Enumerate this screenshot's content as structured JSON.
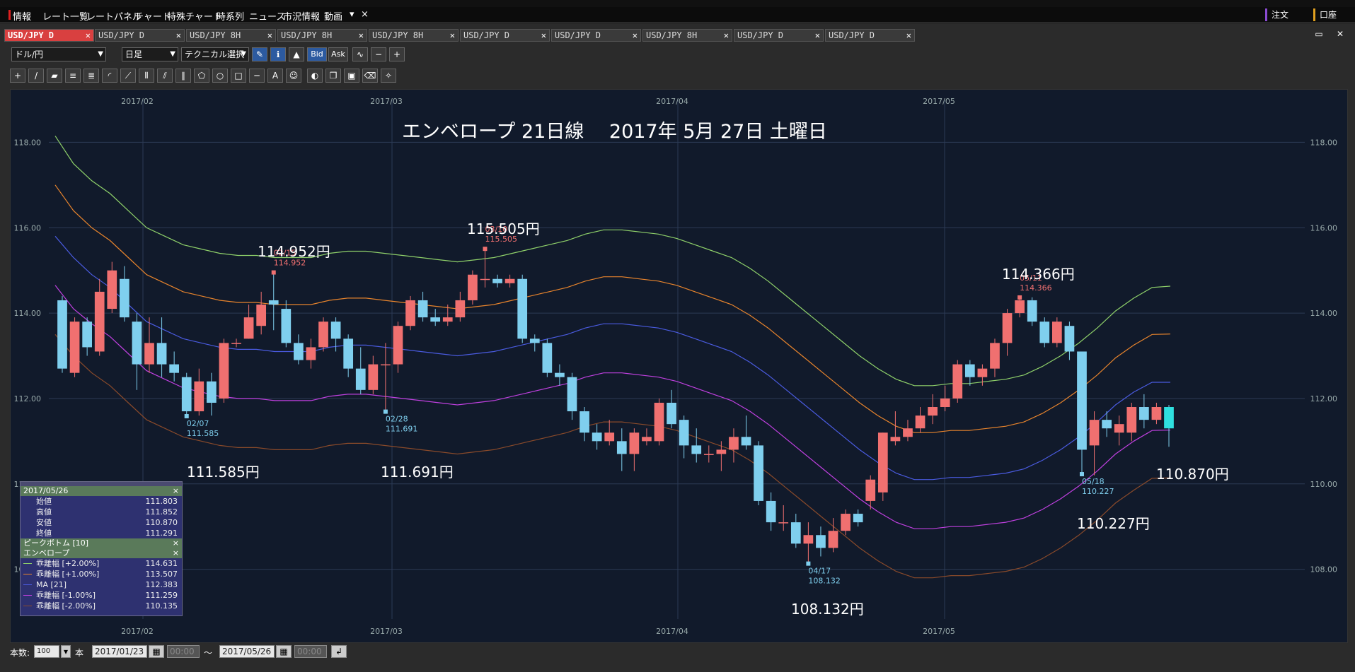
{
  "menubar": {
    "items": [
      "情報",
      "レート一覧",
      "レートパネル",
      "チャート",
      "特殊チャート",
      "時系列",
      "ニュース",
      "市況情報",
      "動画"
    ],
    "close": "×",
    "more": "▾",
    "right_buttons": [
      "注文",
      "口座"
    ]
  },
  "tabs": [
    {
      "label": "USD/JPY D",
      "active": true
    },
    {
      "label": "USD/JPY D",
      "active": false
    },
    {
      "label": "USD/JPY 8H",
      "active": false
    },
    {
      "label": "USD/JPY 8H",
      "active": false
    },
    {
      "label": "USD/JPY 8H",
      "active": false
    },
    {
      "label": "USD/JPY D",
      "active": false
    },
    {
      "label": "USD/JPY D",
      "active": false
    },
    {
      "label": "USD/JPY 8H",
      "active": false
    },
    {
      "label": "USD/JPY D",
      "active": false
    },
    {
      "label": "USD/JPY D",
      "active": false
    }
  ],
  "toolbar": {
    "pair": "ドル/円",
    "timeframe": "日足",
    "technical": "テクニカル選択",
    "bid": "Bid",
    "ask": "Ask"
  },
  "chart_title": "エンベロープ 21日線　 2017年 5月 27日 土曜日",
  "annotations": [
    {
      "id": "a1",
      "text": "114.952円"
    },
    {
      "id": "a2",
      "text": "115.505円"
    },
    {
      "id": "a3",
      "text": "114.366円"
    },
    {
      "id": "a4",
      "text": "111.585円"
    },
    {
      "id": "a5",
      "text": "111.691円"
    },
    {
      "id": "a6",
      "text": "108.132円"
    },
    {
      "id": "a7",
      "text": "110.870円"
    },
    {
      "id": "a8",
      "text": "110.227円"
    }
  ],
  "infopanel": {
    "date": "2017/05/26",
    "ohlc": [
      {
        "k": "始値",
        "v": "111.803"
      },
      {
        "k": "高値",
        "v": "111.852"
      },
      {
        "k": "安値",
        "v": "110.870"
      },
      {
        "k": "終値",
        "v": "111.291"
      }
    ],
    "peak_section": "ピークボトム [10]",
    "env_section": "エンベロープ",
    "env_rows": [
      {
        "k": "乖離幅 [+2.00%]",
        "v": "114.631",
        "color": "#8fd16a"
      },
      {
        "k": "乖離幅 [+1.00%]",
        "v": "113.507",
        "color": "#e8842c"
      },
      {
        "k": "MA [21]",
        "v": "112.383",
        "color": "#4a5be0"
      },
      {
        "k": "乖離幅 [-1.00%]",
        "v": "111.259",
        "color": "#c040e0"
      },
      {
        "k": "乖離幅 [-2.00%]",
        "v": "110.135",
        "color": "#8a4a2a"
      }
    ],
    "close": "×"
  },
  "bottombar": {
    "count_label": "本数:",
    "count_value": "100",
    "unit": "本",
    "from_date": "2017/01/23",
    "from_time": "00:00",
    "tilde": "～",
    "to_date": "2017/05/26",
    "to_time": "00:00"
  },
  "chart_data": {
    "type": "candlestick",
    "title": "エンベロープ 21日線　 2017年 5月 27日 土曜日",
    "x_axis_labels": [
      "2017/02",
      "2017/03",
      "2017/04",
      "2017/05"
    ],
    "y_ticks": [
      "108.00",
      "110.00",
      "112.00",
      "114.00",
      "116.00",
      "118.00"
    ],
    "ylim": [
      107.0,
      119.0
    ],
    "grid": true,
    "marker_labels": [
      {
        "date": "02/15",
        "value": "114.952",
        "kind": "peak"
      },
      {
        "date": "03/10",
        "value": "115.505",
        "kind": "peak"
      },
      {
        "date": "05/11",
        "value": "114.366",
        "kind": "peak"
      },
      {
        "date": "02/07",
        "value": "111.585",
        "kind": "bottom"
      },
      {
        "date": "02/28",
        "value": "111.691",
        "kind": "bottom"
      },
      {
        "date": "04/17",
        "value": "108.132",
        "kind": "bottom"
      },
      {
        "date": "05/18",
        "value": "110.227",
        "kind": "bottom"
      }
    ],
    "candles": [
      [
        114.3,
        112.7,
        114.4,
        112.6
      ],
      [
        112.6,
        113.8,
        113.9,
        112.5
      ],
      [
        113.8,
        113.2,
        113.9,
        113.0
      ],
      [
        113.1,
        114.5,
        114.8,
        113.0
      ],
      [
        114.1,
        115.0,
        115.2,
        114.0
      ],
      [
        114.8,
        113.9,
        115.1,
        113.8
      ],
      [
        113.8,
        112.8,
        114.0,
        112.2
      ],
      [
        112.8,
        113.3,
        113.9,
        112.6
      ],
      [
        113.3,
        112.8,
        113.9,
        112.5
      ],
      [
        112.8,
        112.6,
        113.1,
        112.4
      ],
      [
        112.5,
        111.7,
        112.6,
        111.6
      ],
      [
        111.7,
        112.4,
        112.7,
        111.6
      ],
      [
        112.4,
        111.9,
        112.6,
        111.6
      ],
      [
        112.0,
        113.3,
        113.4,
        111.9
      ],
      [
        113.3,
        113.3,
        113.4,
        113.2
      ],
      [
        113.4,
        113.9,
        114.2,
        113.4
      ],
      [
        113.7,
        114.2,
        114.5,
        113.5
      ],
      [
        114.3,
        114.2,
        114.95,
        113.6
      ],
      [
        114.1,
        113.3,
        114.3,
        113.2
      ],
      [
        113.3,
        112.9,
        113.5,
        112.8
      ],
      [
        112.9,
        113.2,
        113.4,
        112.7
      ],
      [
        113.2,
        113.8,
        113.9,
        113.1
      ],
      [
        113.8,
        113.4,
        113.9,
        113.1
      ],
      [
        113.4,
        112.7,
        113.5,
        112.5
      ],
      [
        112.7,
        112.2,
        113.2,
        112.1
      ],
      [
        112.2,
        112.8,
        113.0,
        112.1
      ],
      [
        112.8,
        112.8,
        113.3,
        111.7
      ],
      [
        112.8,
        113.7,
        113.8,
        112.6
      ],
      [
        113.7,
        114.3,
        114.4,
        113.6
      ],
      [
        114.3,
        113.9,
        114.5,
        113.8
      ],
      [
        113.9,
        113.8,
        114.1,
        113.7
      ],
      [
        113.8,
        113.9,
        114.2,
        113.7
      ],
      [
        113.9,
        114.3,
        114.5,
        113.8
      ],
      [
        114.3,
        114.9,
        115.0,
        114.2
      ],
      [
        114.8,
        114.8,
        115.5,
        114.6
      ],
      [
        114.8,
        114.7,
        114.9,
        114.6
      ],
      [
        114.7,
        114.8,
        114.9,
        114.6
      ],
      [
        114.8,
        113.4,
        114.9,
        113.3
      ],
      [
        113.4,
        113.3,
        113.5,
        113.1
      ],
      [
        113.3,
        112.6,
        113.4,
        112.5
      ],
      [
        112.6,
        112.5,
        112.8,
        112.3
      ],
      [
        112.5,
        111.7,
        112.6,
        111.5
      ],
      [
        111.7,
        111.2,
        111.8,
        111.0
      ],
      [
        111.2,
        111.0,
        111.4,
        110.8
      ],
      [
        111.0,
        111.2,
        111.5,
        110.9
      ],
      [
        111.0,
        110.7,
        111.3,
        110.3
      ],
      [
        110.7,
        111.2,
        111.3,
        110.3
      ],
      [
        111.0,
        111.1,
        111.3,
        110.9
      ],
      [
        111.0,
        111.9,
        112.0,
        110.9
      ],
      [
        111.9,
        111.4,
        112.2,
        111.3
      ],
      [
        111.5,
        110.9,
        111.6,
        110.6
      ],
      [
        110.9,
        110.7,
        111.3,
        110.5
      ],
      [
        110.7,
        110.7,
        110.9,
        110.5
      ],
      [
        110.7,
        110.8,
        111.0,
        110.3
      ],
      [
        110.8,
        111.1,
        111.3,
        110.5
      ],
      [
        111.1,
        110.9,
        111.6,
        110.8
      ],
      [
        110.9,
        109.6,
        111.0,
        109.5
      ],
      [
        109.6,
        109.1,
        109.8,
        108.9
      ],
      [
        109.1,
        109.1,
        109.5,
        108.9
      ],
      [
        109.1,
        108.6,
        109.3,
        108.5
      ],
      [
        108.6,
        108.8,
        109.1,
        108.1
      ],
      [
        108.8,
        108.5,
        109.0,
        108.3
      ],
      [
        108.5,
        108.9,
        109.2,
        108.4
      ],
      [
        108.9,
        109.3,
        109.4,
        108.8
      ],
      [
        109.3,
        109.1,
        109.4,
        109.0
      ],
      [
        109.6,
        110.1,
        110.2,
        109.4
      ],
      [
        109.8,
        111.2,
        111.2,
        109.6
      ],
      [
        111.0,
        111.1,
        111.7,
        110.9
      ],
      [
        111.1,
        111.3,
        111.5,
        111.0
      ],
      [
        111.3,
        111.6,
        111.8,
        111.2
      ],
      [
        111.6,
        111.8,
        112.1,
        111.4
      ],
      [
        111.8,
        112.0,
        112.3,
        111.7
      ],
      [
        112.0,
        112.8,
        112.9,
        111.9
      ],
      [
        112.8,
        112.5,
        112.9,
        112.3
      ],
      [
        112.5,
        112.7,
        112.8,
        112.3
      ],
      [
        112.7,
        113.3,
        113.4,
        112.5
      ],
      [
        113.3,
        114.0,
        114.1,
        113.0
      ],
      [
        114.0,
        114.3,
        114.4,
        113.9
      ],
      [
        114.3,
        113.8,
        114.37,
        113.7
      ],
      [
        113.8,
        113.3,
        113.9,
        113.2
      ],
      [
        113.3,
        113.8,
        113.9,
        113.2
      ],
      [
        113.7,
        113.1,
        113.8,
        112.9
      ],
      [
        113.1,
        110.8,
        113.1,
        110.2
      ],
      [
        110.9,
        111.5,
        111.7,
        110.2
      ],
      [
        111.5,
        111.3,
        111.7,
        111.1
      ],
      [
        111.2,
        111.4,
        111.6,
        110.9
      ],
      [
        111.2,
        111.8,
        111.9,
        111.0
      ],
      [
        111.8,
        111.5,
        112.1,
        111.3
      ],
      [
        111.5,
        111.8,
        111.9,
        111.4
      ],
      [
        111.8,
        111.3,
        111.85,
        110.87
      ]
    ],
    "series": [
      {
        "name": "乖離幅 [+2.00%]",
        "color": "#8fd16a",
        "values": [
          118.15,
          117.5,
          117.1,
          116.8,
          116.4,
          116.0,
          115.8,
          115.6,
          115.5,
          115.4,
          115.35,
          115.35,
          115.3,
          115.3,
          115.3,
          115.4,
          115.45,
          115.45,
          115.4,
          115.35,
          115.3,
          115.25,
          115.2,
          115.25,
          115.3,
          115.4,
          115.5,
          115.6,
          115.7,
          115.85,
          115.95,
          115.95,
          115.9,
          115.85,
          115.75,
          115.6,
          115.45,
          115.3,
          115.05,
          114.75,
          114.4,
          114.05,
          113.7,
          113.35,
          113.0,
          112.7,
          112.45,
          112.3,
          112.3,
          112.35,
          112.35,
          112.4,
          112.45,
          112.55,
          112.75,
          113.0,
          113.3,
          113.65,
          114.05,
          114.35,
          114.6,
          114.63
        ]
      },
      {
        "name": "乖離幅 [+1.00%]",
        "color": "#e8842c",
        "values": [
          117.0,
          116.4,
          116.0,
          115.7,
          115.3,
          114.9,
          114.7,
          114.5,
          114.4,
          114.3,
          114.25,
          114.25,
          114.2,
          114.2,
          114.2,
          114.3,
          114.35,
          114.35,
          114.3,
          114.25,
          114.2,
          114.15,
          114.1,
          114.15,
          114.2,
          114.3,
          114.4,
          114.5,
          114.6,
          114.75,
          114.85,
          114.85,
          114.8,
          114.75,
          114.65,
          114.5,
          114.35,
          114.2,
          113.95,
          113.65,
          113.3,
          112.95,
          112.6,
          112.25,
          111.9,
          111.6,
          111.35,
          111.2,
          111.2,
          111.25,
          111.25,
          111.3,
          111.35,
          111.45,
          111.65,
          111.9,
          112.2,
          112.55,
          112.95,
          113.25,
          113.5,
          113.51
        ]
      },
      {
        "name": "MA [21]",
        "color": "#4a5be0",
        "values": [
          115.8,
          115.3,
          114.9,
          114.6,
          114.2,
          113.8,
          113.6,
          113.4,
          113.3,
          113.2,
          113.15,
          113.15,
          113.1,
          113.1,
          113.1,
          113.2,
          113.25,
          113.25,
          113.2,
          113.15,
          113.1,
          113.05,
          113.0,
          113.05,
          113.1,
          113.2,
          113.3,
          113.4,
          113.5,
          113.65,
          113.75,
          113.75,
          113.7,
          113.65,
          113.55,
          113.4,
          113.25,
          113.1,
          112.85,
          112.55,
          112.2,
          111.85,
          111.5,
          111.15,
          110.8,
          110.5,
          110.25,
          110.1,
          110.1,
          110.15,
          110.15,
          110.2,
          110.25,
          110.35,
          110.55,
          110.8,
          111.1,
          111.45,
          111.85,
          112.15,
          112.38,
          112.38
        ]
      },
      {
        "name": "乖離幅 [-1.00%]",
        "color": "#c040e0",
        "values": [
          114.65,
          114.1,
          113.75,
          113.45,
          113.05,
          112.65,
          112.45,
          112.25,
          112.15,
          112.05,
          112.0,
          112.0,
          111.95,
          111.95,
          111.95,
          112.05,
          112.1,
          112.1,
          112.05,
          112.0,
          111.95,
          111.9,
          111.85,
          111.9,
          111.95,
          112.05,
          112.15,
          112.25,
          112.35,
          112.5,
          112.6,
          112.6,
          112.55,
          112.5,
          112.4,
          112.25,
          112.1,
          111.95,
          111.7,
          111.4,
          111.05,
          110.7,
          110.35,
          110.0,
          109.65,
          109.35,
          109.1,
          108.95,
          108.95,
          109.0,
          109.0,
          109.05,
          109.1,
          109.2,
          109.4,
          109.65,
          109.95,
          110.3,
          110.7,
          111.0,
          111.25,
          111.26
        ]
      },
      {
        "name": "乖離幅 [-2.00%]",
        "color": "#8a4a2a",
        "values": [
          113.5,
          113.0,
          112.6,
          112.3,
          111.9,
          111.5,
          111.3,
          111.1,
          111.0,
          110.9,
          110.85,
          110.85,
          110.8,
          110.8,
          110.8,
          110.9,
          110.95,
          110.95,
          110.9,
          110.85,
          110.8,
          110.75,
          110.7,
          110.75,
          110.8,
          110.9,
          111.0,
          111.1,
          111.2,
          111.35,
          111.45,
          111.45,
          111.4,
          111.35,
          111.25,
          111.1,
          110.95,
          110.8,
          110.55,
          110.25,
          109.9,
          109.55,
          109.2,
          108.85,
          108.5,
          108.2,
          107.95,
          107.8,
          107.8,
          107.85,
          107.85,
          107.9,
          107.95,
          108.05,
          108.25,
          108.5,
          108.8,
          109.15,
          109.55,
          109.85,
          110.13,
          110.14
        ]
      }
    ]
  }
}
